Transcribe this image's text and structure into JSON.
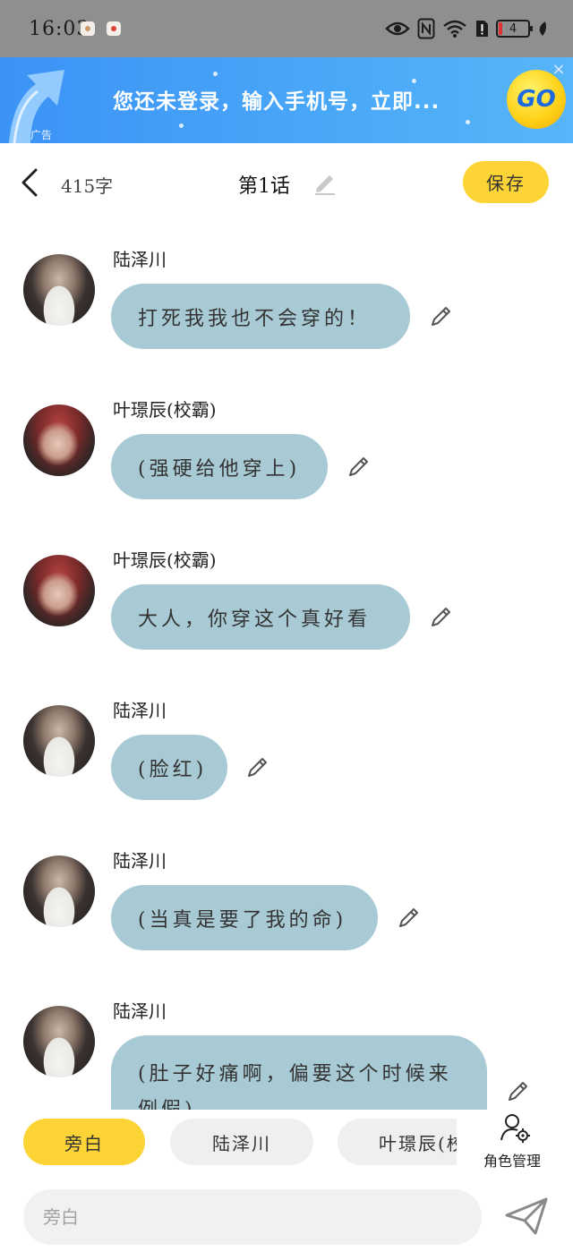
{
  "status_bar": {
    "time": "16:03",
    "battery": "4"
  },
  "ad": {
    "text": "您还未登录，输入手机号，立即...",
    "tag": "广告",
    "go_label": "GO",
    "close_glyph": "×"
  },
  "header": {
    "word_count": "415字",
    "chapter_title": "第1话",
    "save_label": "保存"
  },
  "messages": [
    {
      "speaker": "陆泽川",
      "text": "打死我我也不会穿的！",
      "avatar": "avatar-luzechuan"
    },
    {
      "speaker": "叶璟辰(校霸)",
      "text": "(强硬给他穿上)",
      "avatar": "avatar-yejingchen"
    },
    {
      "speaker": "叶璟辰(校霸)",
      "text": "大人，你穿这个真好看",
      "avatar": "avatar-yejingchen"
    },
    {
      "speaker": "陆泽川",
      "text": "(脸红)",
      "avatar": "avatar-luzechuan"
    },
    {
      "speaker": "陆泽川",
      "text": "(当真是要了我的命)",
      "avatar": "avatar-luzechuan"
    },
    {
      "speaker": "陆泽川",
      "text": "(肚子好痛啊，偏要这个时候来例假)",
      "avatar": "avatar-luzechuan"
    }
  ],
  "roles": {
    "chips": [
      "旁白",
      "陆泽川",
      "叶璟辰(校霸)"
    ],
    "active": "旁白",
    "manage_label": "角色管理"
  },
  "composer": {
    "placeholder": "旁白"
  },
  "icons": {
    "back": "chevron-left-icon",
    "edit": "pencil-icon",
    "send": "paper-plane-icon",
    "role_manage": "user-gear-icon"
  }
}
